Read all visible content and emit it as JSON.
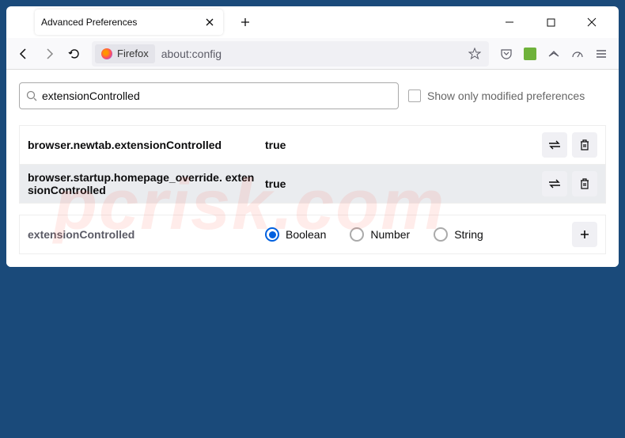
{
  "tab": {
    "title": "Advanced Preferences"
  },
  "urlbar": {
    "identity_label": "Firefox",
    "url": "about:config"
  },
  "search": {
    "value": "extensionControlled",
    "filter_label": "Show only modified preferences"
  },
  "prefs": [
    {
      "name": "browser.newtab.extensionControlled",
      "value": "true"
    },
    {
      "name": "browser.startup.homepage_override. extensionControlled",
      "value": "true"
    }
  ],
  "newpref": {
    "name": "extensionControlled",
    "types": {
      "boolean": "Boolean",
      "number": "Number",
      "string": "String"
    }
  },
  "watermark": "pcrisk.com"
}
